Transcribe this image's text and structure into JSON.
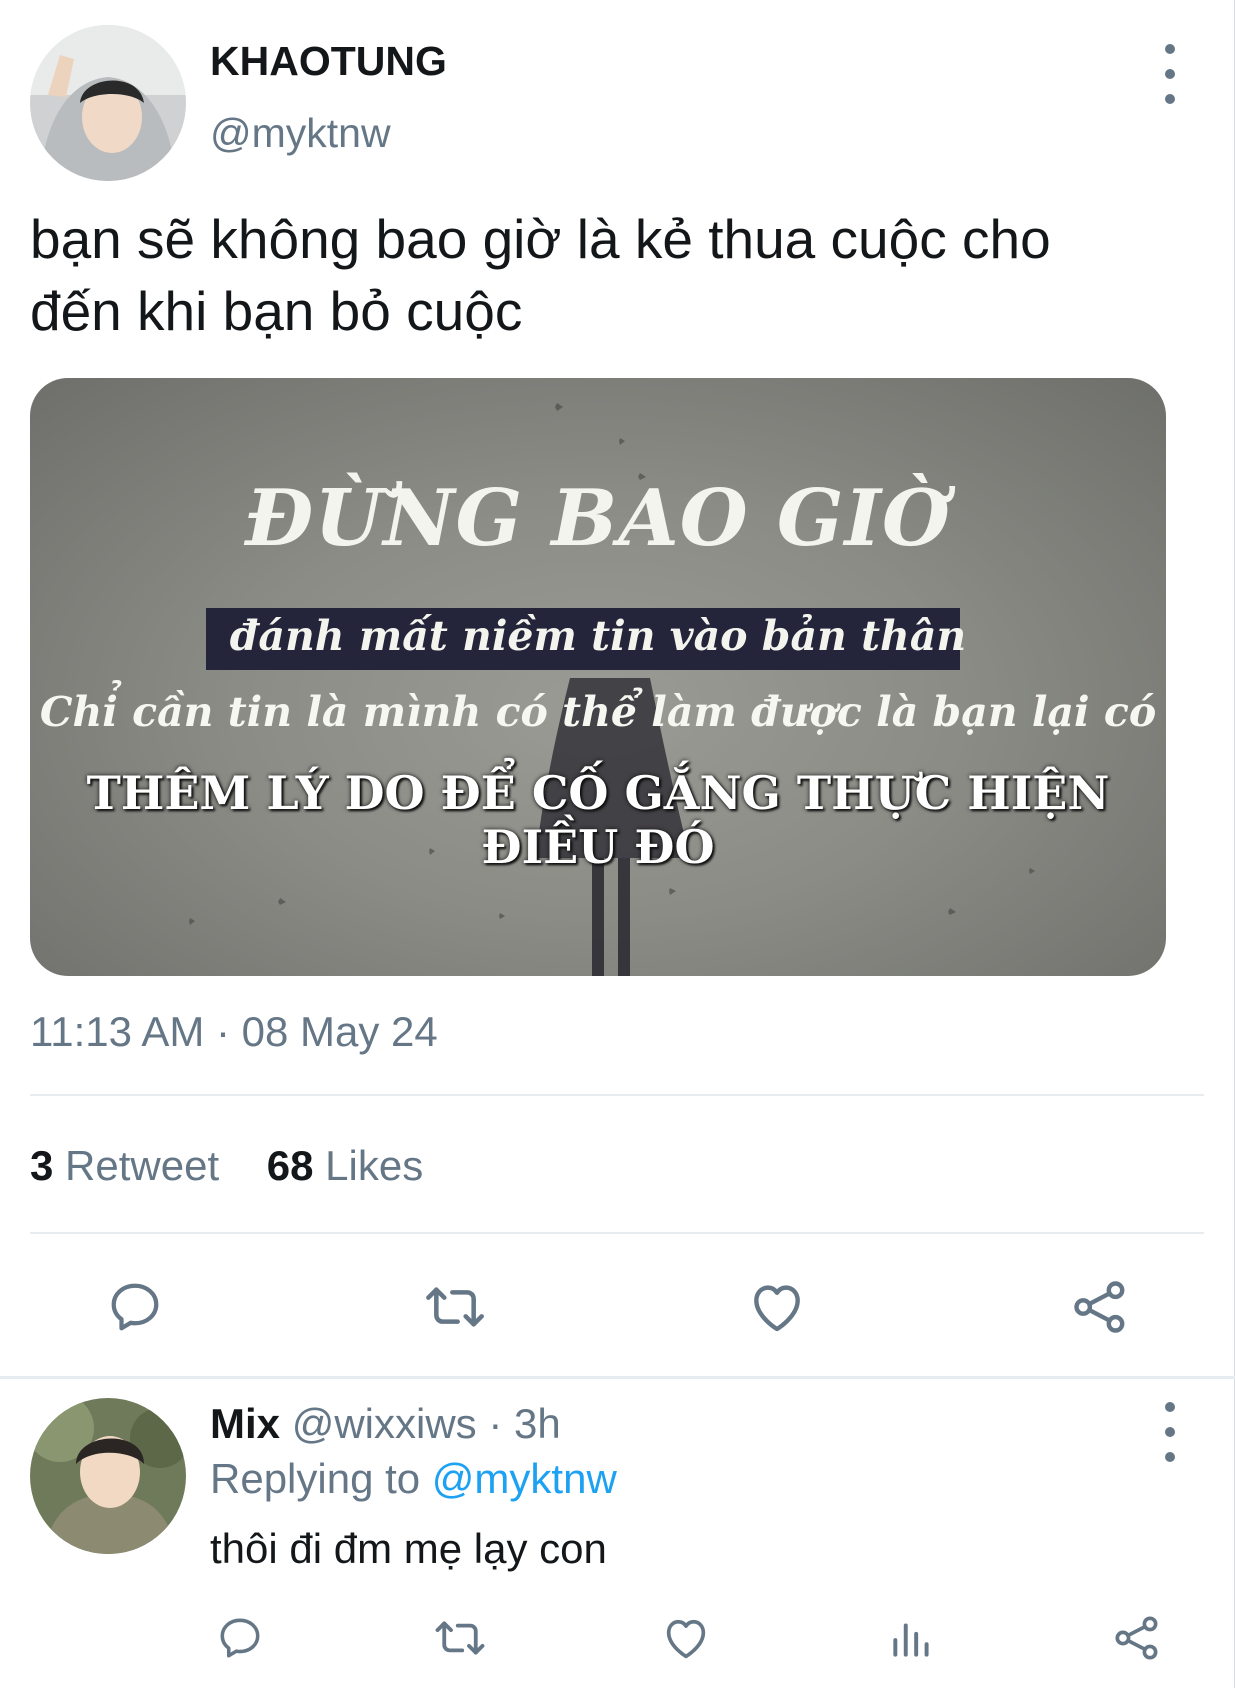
{
  "tweet": {
    "display_name": "KHAOTUNG",
    "handle": "@myktnw",
    "text_line1": "bạn sẽ không bao giờ là kẻ thua cuộc cho",
    "text_line2": "đến khi bạn bỏ cuộc",
    "image": {
      "title": "ĐỪNG BAO GIỜ",
      "banner": "đánh mất niềm tin vào bản thân",
      "line2": "Chỉ cần tin là mình có thể làm được là bạn lại có",
      "line3": "THÊM LÝ DO ĐỂ CỐ GẮNG THỰC HIỆN ĐIỀU ĐÓ"
    },
    "timestamp": "11:13 AM · 08 May 24",
    "retweet_count": "3",
    "retweet_label": "Retweet",
    "like_count": "68",
    "like_label": "Likes",
    "actions": [
      "reply-icon",
      "retweet-icon",
      "like-icon",
      "share-icon"
    ]
  },
  "reply": {
    "display_name": "Mix",
    "handle_time": "@wixxiws · 3h",
    "replying_prefix": "Replying to",
    "replying_handle": "@myktnw",
    "text": "thôi đi đm mẹ lạy con",
    "actions": [
      "reply-icon",
      "retweet-icon",
      "like-icon",
      "analytics-icon",
      "share-icon"
    ]
  },
  "colors": {
    "text": "#14171a",
    "secondary": "#657786",
    "link": "#1da1f2",
    "divider": "#e6ecf0"
  }
}
